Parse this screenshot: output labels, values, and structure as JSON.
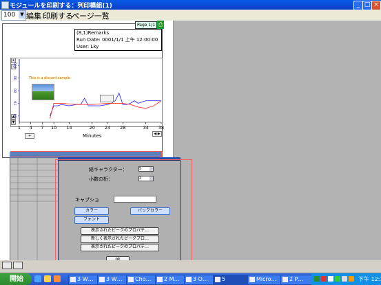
{
  "window": {
    "title": "モジュールを印刷する：列印模組(1)",
    "min": "_",
    "max": "□",
    "close": "×"
  },
  "menu": {
    "zoom_value": "100",
    "items": [
      "編集",
      "印刷する",
      "ページ一覧"
    ]
  },
  "report": {
    "page_indicator": "Page 1/1",
    "remarks": [
      "(8,1)Remarks",
      "Run  Date:  0001/1/1 上午 12:00:00",
      "User: Lky"
    ],
    "sample_label": "This is a discard sample"
  },
  "chart_data": {
    "type": "line",
    "xlabel": "Minutes",
    "x_ticks": [
      "1",
      "4",
      "7",
      "10",
      "14",
      "20",
      "24",
      "28",
      "34",
      "38"
    ],
    "y_ticks": [
      "100",
      "90",
      "80",
      "70",
      "60"
    ],
    "series": [
      {
        "color": "#3030ff",
        "x": [
          9,
          10,
          11,
          12,
          14,
          16,
          17,
          18,
          19,
          20,
          22,
          24,
          25,
          26,
          27,
          28,
          29,
          30,
          31,
          32,
          33,
          34,
          36,
          38
        ],
        "y": [
          60,
          68,
          68,
          69,
          68,
          69,
          69,
          74,
          68,
          68,
          68,
          69,
          70,
          72,
          78,
          69,
          69,
          70,
          72,
          70,
          71,
          72,
          72,
          72
        ]
      },
      {
        "color": "#ff3030",
        "x": [
          9,
          10,
          12,
          16,
          20,
          24,
          28,
          30,
          32,
          34,
          36,
          38
        ],
        "y": [
          58,
          70,
          70,
          69,
          69,
          70,
          70,
          69,
          67,
          66,
          68,
          72
        ]
      }
    ]
  },
  "dialog": {
    "total_chars_label": "総キャラクター：",
    "total_chars_value": "5",
    "decimals_label": "小数の桁：",
    "decimals_value": "2",
    "caption_label": "キャプショ",
    "caption_value": "",
    "color_button": "カラー",
    "backcolor_button": "バックカラー",
    "font_button": "フォント",
    "peak_btn1": "表示されたピークのプロパテ…",
    "peak_btn2": "新しく表示されたピークプロ…",
    "peak_btn3": "表示されたピークのプロパテ…",
    "ok_button": "ok"
  },
  "taskbar": {
    "start": "開始",
    "tasks": [
      "3 W…",
      "3 W…",
      "Cho…",
      "2 M…",
      "3 O…",
      "5",
      "Micro…",
      "2 P…"
    ],
    "clock": "下午 12:17"
  }
}
